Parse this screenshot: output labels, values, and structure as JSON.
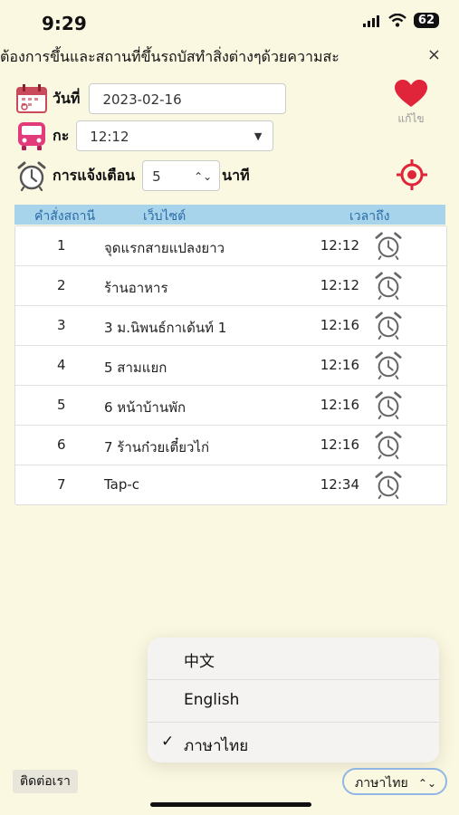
{
  "status": {
    "time": "9:29",
    "battery": "62"
  },
  "marquee": {
    "text": "ต้องการขึ้นและสถานที่ขึ้นรถบัสทำสิ่งต่างๆด้วยความสะ",
    "close": "×"
  },
  "form": {
    "date_label": "วันที่",
    "date_value": "2023-02-16",
    "shift_label": "กะ",
    "shift_value": "12:12",
    "alert_label": "การแจ้งเตือน",
    "alert_value": "5",
    "alert_unit": "นาที"
  },
  "favorite": {
    "label": "แก้ไข"
  },
  "table": {
    "headers": [
      "คำสั่งสถานี",
      "เว็บไซต์",
      "เวลาถึง"
    ],
    "rows": [
      {
        "num": "1",
        "name": "จุดแรกสายแปลงยาว",
        "time": "12:12"
      },
      {
        "num": "2",
        "name": "ร้านอาหาร",
        "time": "12:12"
      },
      {
        "num": "3",
        "name": "3 ม.นิพนธ์กาเด้นท์ 1",
        "time": "12:16"
      },
      {
        "num": "4",
        "name": "5 สามแยก",
        "time": "12:16"
      },
      {
        "num": "5",
        "name": "6 หน้าบ้านพัก",
        "time": "12:16"
      },
      {
        "num": "6",
        "name": "7 ร้านก๋วยเตี๋ยวไก่",
        "time": "12:16"
      },
      {
        "num": "7",
        "name": "Tap-c",
        "time": "12:34"
      }
    ]
  },
  "language_menu": {
    "items": [
      "中文",
      "English",
      "ภาษาไทย"
    ],
    "selected": "ภาษาไทย",
    "check": "✓"
  },
  "footer": {
    "contact": "ติดต่อเรา",
    "language": "ภาษาไทย"
  }
}
